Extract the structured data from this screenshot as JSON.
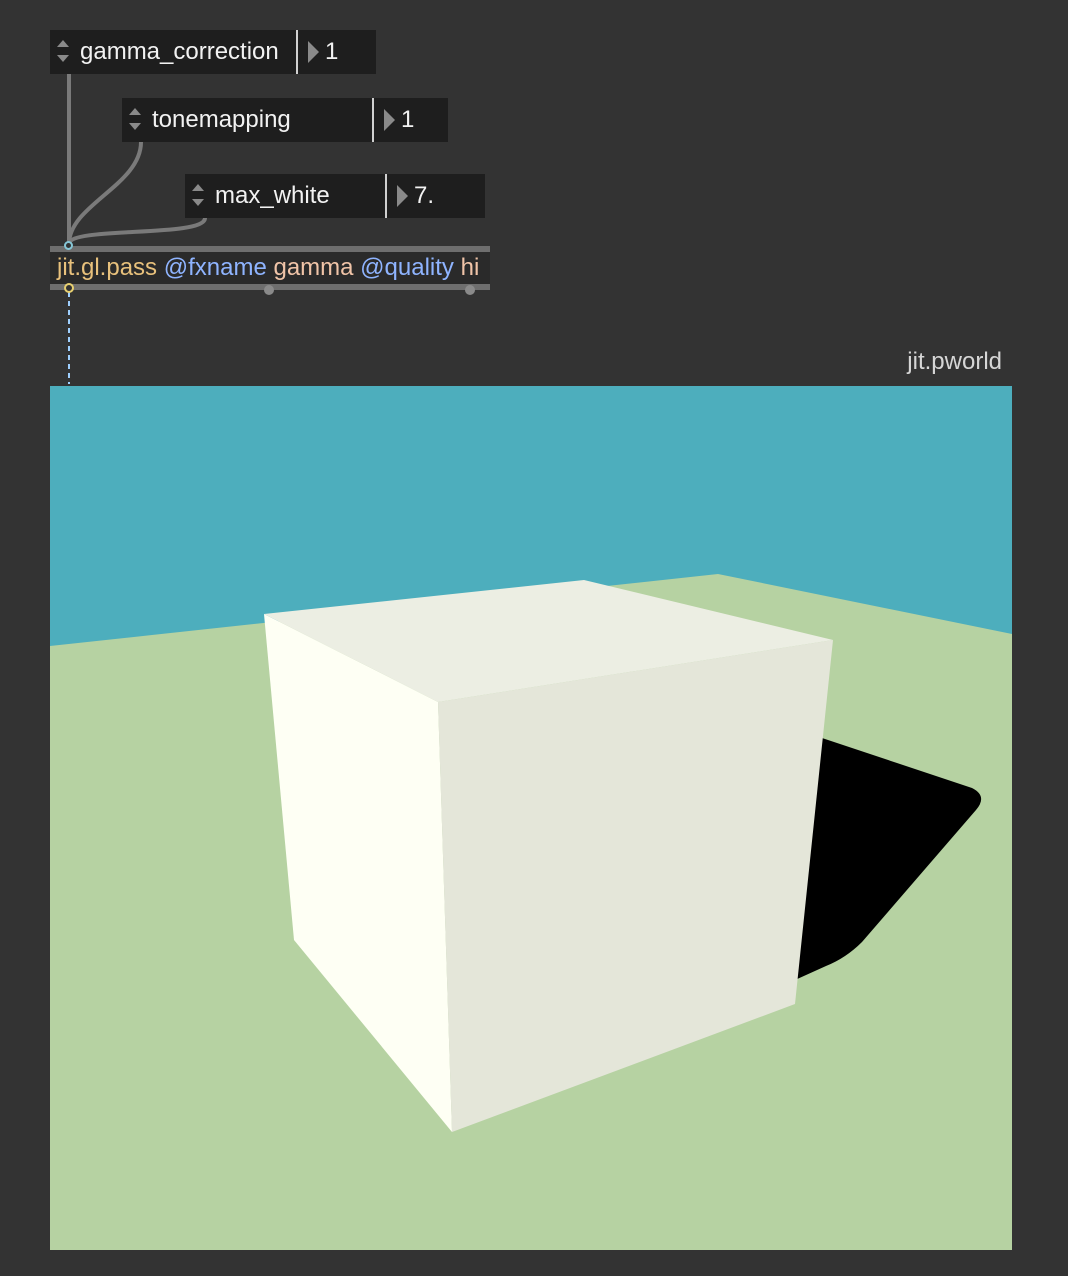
{
  "patch": {
    "attrui": [
      {
        "name": "gamma_correction",
        "value": "1"
      },
      {
        "name": "tonemapping",
        "value": "1"
      },
      {
        "name": "max_white",
        "value": "7."
      }
    ],
    "pass_object": {
      "class": "jit.gl.pass",
      "attr1": "@fxname",
      "arg1": "gamma",
      "attr2": "@quality",
      "arg2": "hi"
    },
    "pworld_label": "jit.pworld"
  },
  "colors": {
    "canvas": "#333333",
    "sky": "#4daebd",
    "ground": "#b6d2a2",
    "cube_left": "#fefff4",
    "cube_front": "#e4e6d9",
    "cube_top": "#eceee3",
    "shadow": "#000000",
    "class_text": "#e8c17c",
    "attr_text": "#8fb4ff"
  }
}
